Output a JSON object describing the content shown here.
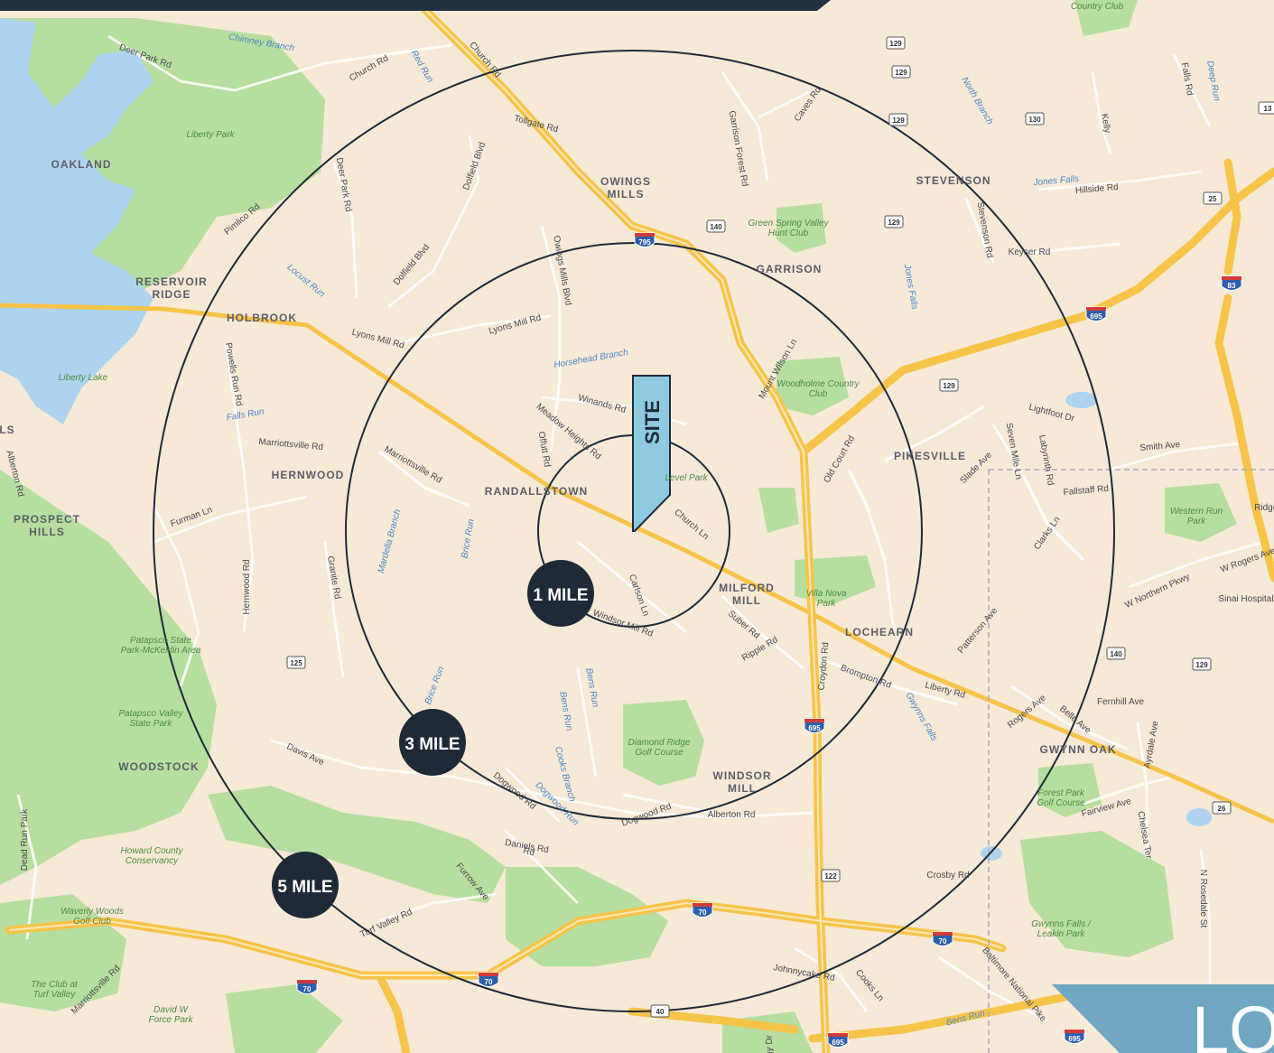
{
  "header": {
    "bar_color": "#223041"
  },
  "corner_banner": {
    "text": "LOC",
    "color": "#6fa6c0"
  },
  "site_marker": {
    "label": "SITE",
    "color": "#8ecbe0"
  },
  "radius_rings": [
    {
      "label": "1 MILE",
      "miles": 1
    },
    {
      "label": "3 MILE",
      "miles": 3
    },
    {
      "label": "5 MILE",
      "miles": 5
    }
  ],
  "colors": {
    "land": "#f6e9d6",
    "park": "#b6dea0",
    "water": "#aed3ef",
    "highway": "#f7c44a",
    "ring": "#1e2a38",
    "badge": "#1e2a38"
  },
  "places": [
    "OAKLAND",
    "RESERVOIR RIDGE",
    "HOLBROOK",
    "OWINGS MILLS",
    "GARRISON",
    "STEVENSON",
    "PIKESVILLE",
    "RANDALLSTOWN",
    "HERNWOOD",
    "PROSPECT HILLS",
    "MILFORD MILL",
    "LOCHEARN",
    "WINDSOR MILL",
    "WOODSTOCK",
    "GWYNN OAK",
    "LS"
  ],
  "roads": [
    "Deer Park Rd",
    "Church Rd",
    "Red Run",
    "Church Rd",
    "Tollgate Rd",
    "Dolfield Blvd",
    "Deer Park Rd",
    "Dolfield Blvd",
    "Locust Run",
    "Lyons Mill Rd",
    "Lyons Mill Rd",
    "Owings Mills Blvd",
    "Garrison Forest Rd",
    "Caves Rd",
    "North Branch",
    "Jones Falls",
    "Hillside Rd",
    "Keyser Rd",
    "Stevenson Rd",
    "Jones Falls",
    "Falls Rd",
    "Deep Run",
    "Powells Run Rd",
    "Falls Run",
    "Marriottsville Rd",
    "Marriottsville Rd",
    "Furman Ln",
    "Hernwood Rd",
    "Granite Rd",
    "Mardella Branch",
    "Brice Run",
    "Offutt Rd",
    "Meadow Heights Rd",
    "Winands Rd",
    "Horsehead Branch",
    "Church Ln",
    "Carlson Ln",
    "Windsor Mill Rd",
    "Mount Wilson Ln",
    "Old Court Rd",
    "Lightfoot Dr",
    "Seven Mile Ln",
    "Labyrinth Rd",
    "Slade Ave",
    "Clarks Ln",
    "Fallstaff Rd",
    "Smith Ave",
    "W Rogers Ave",
    "W Northern Pkwy",
    "Sinai Hospital",
    "Patterson Ave",
    "Liberty Rd",
    "Suber Rd",
    "Ripple Rd",
    "Croydon Rd",
    "Brompton Rd",
    "Gwynns Falls",
    "Rogers Ave",
    "Belle Ave",
    "Fernhill Ave",
    "Ayrdale Ave",
    "Fairview Ave",
    "Chelsea Ter",
    "N Rosedale St",
    "Brice Run",
    "Bens Run",
    "Bens Run",
    "Davis Ave",
    "Dogwood Rd",
    "Dogwood Run",
    "Dogwood Rd",
    "Alberton Rd",
    "Daniels Rd",
    "Furrow Ave",
    "Turf Valley Rd",
    "Marriottsville Rd",
    "Dead Run Park",
    "Crosby Rd",
    "Johnnycake Rd",
    "Cooks Ln",
    "Baltimore National Pike",
    "Bens Run",
    "Cooks Branch",
    "Chimney Branch",
    "Pimlico Rd",
    "Kelly",
    "Ridge Rd",
    "Alberton Rd",
    "Rd",
    "ay Dr"
  ],
  "parks": [
    "Liberty Park",
    "Green Spring Valley Hunt Club",
    "Woodholme Country Club",
    "Villa Nova Park",
    "Patapsco State Park-McKeldin Area",
    "Patapsco Valley State Park",
    "Howard County Conservancy",
    "Waverly Woods Golf Club",
    "The Club at Turf Valley",
    "David W Force Park",
    "Diamond Ridge Golf Course",
    "Forest Park Golf Course",
    "Gwynns Falls / Leakin Park",
    "Western Run Park",
    "Country Club",
    "Liberty Lake",
    "Level Park"
  ],
  "shields": [
    "129",
    "129",
    "129",
    "130",
    "140",
    "129",
    "129",
    "125",
    "122",
    "140",
    "129",
    "26",
    "25",
    "13",
    "40",
    "70",
    "70",
    "70",
    "70",
    "83",
    "695",
    "695",
    "695",
    "695",
    "795"
  ]
}
